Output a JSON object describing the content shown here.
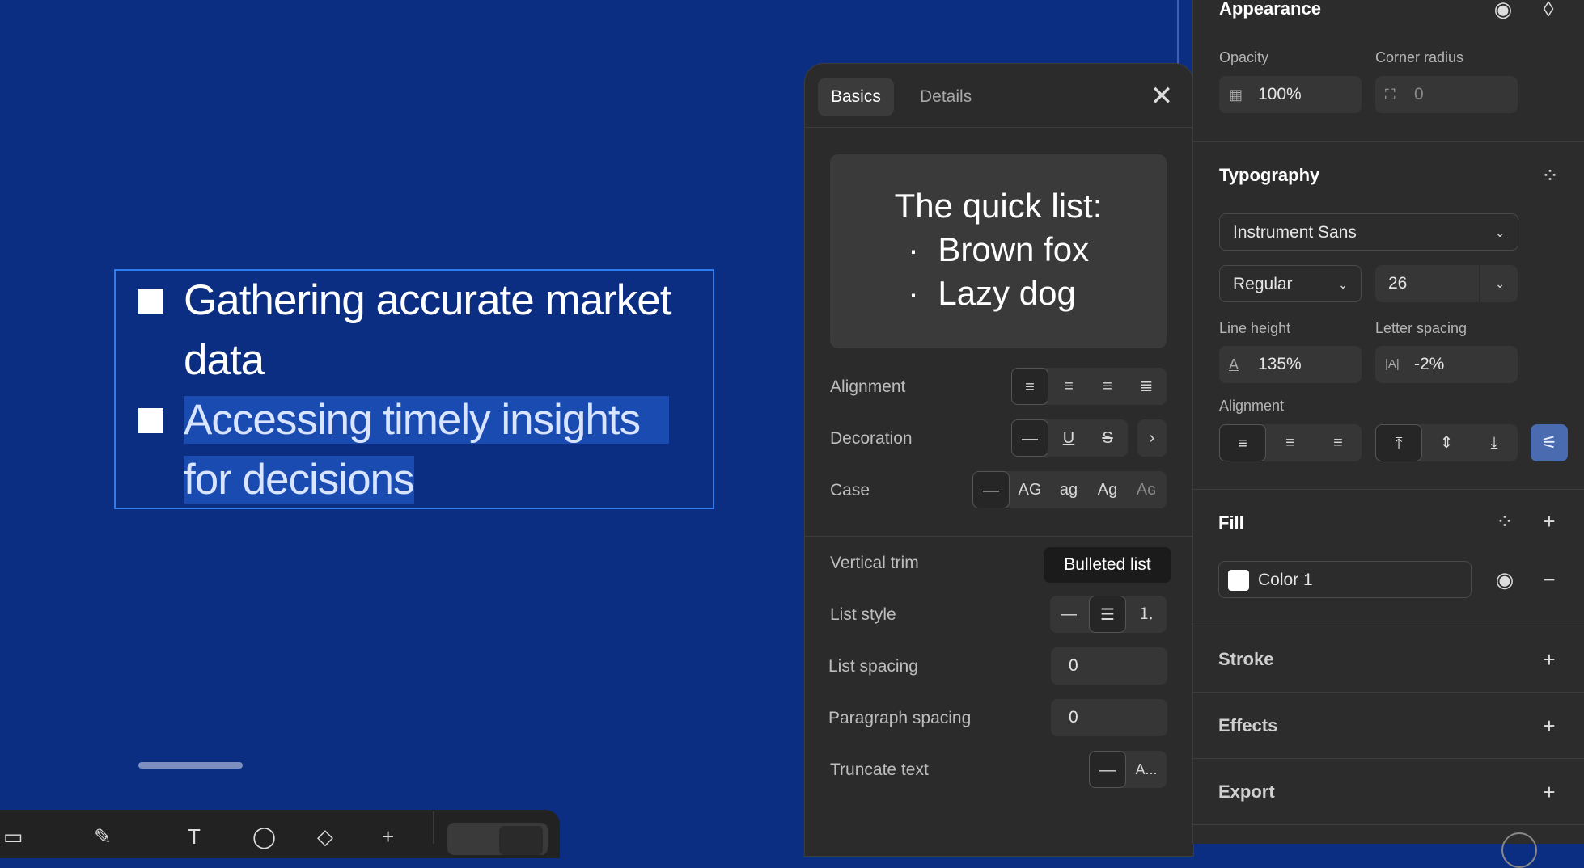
{
  "canvas": {
    "list_items": [
      {
        "line1": "Gathering accurate market",
        "line2": "data"
      },
      {
        "line1": "Accessing timely insights",
        "line2": "for decisions"
      }
    ]
  },
  "toolbar": {
    "tools": [
      "frame-icon",
      "pen-icon",
      "text-icon",
      "ellipse-icon",
      "components-icon",
      "plus-icon"
    ],
    "glyphs": [
      "▭",
      "✎",
      "T",
      "◯",
      "◇",
      "+"
    ]
  },
  "popover": {
    "tabs": [
      "Basics",
      "Details"
    ],
    "close_glyph": "✕",
    "preview": {
      "title": "The quick list:",
      "items": [
        "Brown fox",
        "Lazy dog"
      ],
      "bullet": "·"
    },
    "rows": {
      "alignment": "Alignment",
      "decoration": "Decoration",
      "case": "Case",
      "vertical_trim": "Vertical trim",
      "list_style": "List style",
      "list_spacing": "List spacing",
      "paragraph_spacing": "Paragraph spacing",
      "truncate_text": "Truncate text"
    },
    "case_options": [
      "—",
      "AG",
      "ag",
      "Ag",
      "Aɢ"
    ],
    "decoration_options": [
      "—",
      "U",
      "S",
      "›"
    ],
    "list_style_options": [
      "—",
      "☰",
      "⒈"
    ],
    "truncate_options": [
      "—",
      "A..."
    ],
    "list_spacing_value": "0",
    "paragraph_spacing_value": "0",
    "tooltip": "Bulleted list"
  },
  "panel": {
    "appearance": {
      "title": "Appearance",
      "opacity_label": "Opacity",
      "opacity_value": "100%",
      "corner_radius_label": "Corner radius",
      "corner_radius_value": "0"
    },
    "typography": {
      "title": "Typography",
      "font_family": "Instrument Sans",
      "font_weight": "Regular",
      "font_size": "26",
      "line_height_label": "Line height",
      "line_height_value": "135%",
      "letter_spacing_label": "Letter spacing",
      "letter_spacing_value": "-2%",
      "alignment_label": "Alignment"
    },
    "fill": {
      "title": "Fill",
      "color_name": "Color 1",
      "color": "#ffffff"
    },
    "stroke": {
      "title": "Stroke"
    },
    "effects": {
      "title": "Effects"
    },
    "export": {
      "title": "Export"
    }
  },
  "colors": {
    "canvas": "#0c2e82",
    "selection": "#2d7cf0",
    "panel": "#2c2c2c",
    "accent": "#4a6bb0"
  }
}
